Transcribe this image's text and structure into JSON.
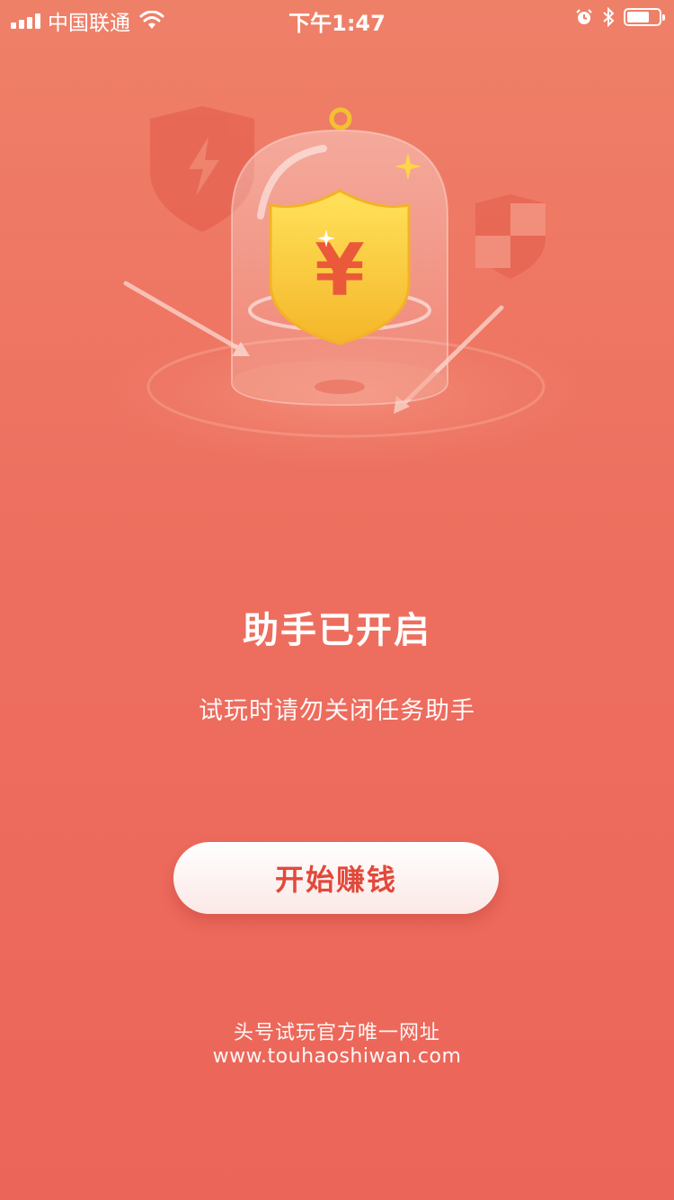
{
  "status_bar": {
    "carrier": "中国联通",
    "time": "下午1:47",
    "battery_level": 0.7
  },
  "main": {
    "title": "助手已开启",
    "subtitle": "试玩时请勿关闭任务助手",
    "start_button_label": "开始赚钱",
    "currency_symbol": "¥"
  },
  "footer": {
    "line1": "头号试玩官方唯一网址",
    "url": "www.touhaoshiwan.com"
  },
  "colors": {
    "background_top": "#ef8068",
    "background_bottom": "#ec6559",
    "button_text": "#e2493a",
    "shield_gold": "#f8c43a"
  },
  "icons": [
    "signal-icon",
    "wifi-icon",
    "alarm-icon",
    "bluetooth-icon",
    "battery-icon",
    "shield-lightning-icon",
    "shield-checker-icon",
    "yen-shield-icon",
    "sparkle-icon"
  ]
}
